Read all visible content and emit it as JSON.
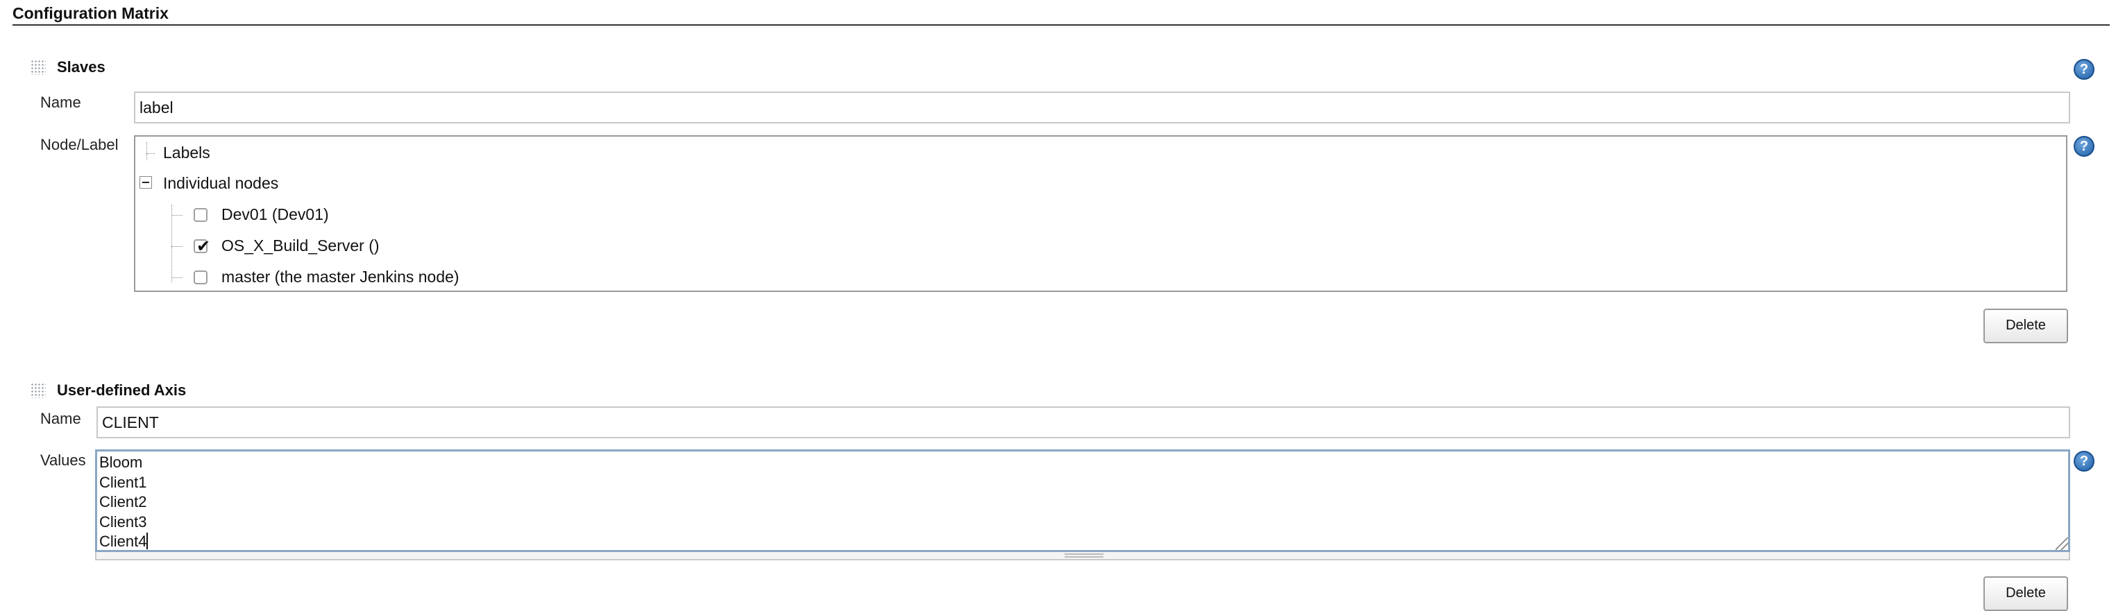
{
  "section": {
    "title": "Configuration Matrix"
  },
  "slaves": {
    "title": "Slaves",
    "name_label": "Name",
    "name_value": "label",
    "node_label": "Node/Label",
    "tree": {
      "labels": "Labels",
      "individual_nodes": "Individual nodes",
      "nodes": [
        {
          "label": "Dev01 (Dev01)",
          "checked": false
        },
        {
          "label": "OS_X_Build_Server ()",
          "checked": true
        },
        {
          "label": "master (the master Jenkins node)",
          "checked": false
        }
      ]
    },
    "delete_label": "Delete"
  },
  "user_axis": {
    "title": "User-defined Axis",
    "name_label": "Name",
    "name_value": "CLIENT",
    "values_label": "Values",
    "values": [
      "Bloom",
      "Client1",
      "Client2",
      "Client3",
      "Client4"
    ],
    "delete_label": "Delete"
  },
  "help": {
    "glyph": "?"
  }
}
